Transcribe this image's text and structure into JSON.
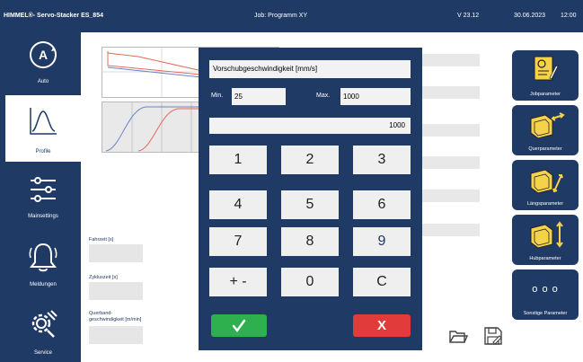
{
  "topbar": {
    "app_title": "HIMMEL®- Servo-Stacker ES_854",
    "job": "Job: Programm XY",
    "version": "V 23.12",
    "date": "30.06.2023",
    "time": "12:00"
  },
  "sidebar": {
    "items": [
      {
        "label": "Auto",
        "icon": "auto-icon"
      },
      {
        "label": "Profile",
        "icon": "profile-curve-icon",
        "active": true
      },
      {
        "label": "Mainsettings",
        "icon": "sliders-icon"
      },
      {
        "label": "Meldungen",
        "icon": "bell-icon"
      },
      {
        "label": "Service",
        "icon": "gear-wrench-icon"
      }
    ]
  },
  "main": {
    "fields": [
      {
        "label": "Fahrzeit [s]"
      },
      {
        "label": "Zykluszeit [s]"
      },
      {
        "label": "Querband-\ngeschwindigkeit [m/min]"
      }
    ]
  },
  "dialog": {
    "title": "Vorschubgeschwindigkeit [mm/s]",
    "min_label": "Min.",
    "min_value": "25",
    "max_label": "Max.",
    "max_value": "1000",
    "current_value": "1000",
    "keys": [
      "1",
      "2",
      "3",
      "4",
      "5",
      "6",
      "7",
      "8",
      "9",
      "+ -",
      "0",
      "C"
    ],
    "confirm_icon": "check-icon",
    "cancel_label": "X"
  },
  "right_panel": {
    "buttons": [
      {
        "label": "Jobparameter",
        "icon": "job-doc-icon"
      },
      {
        "label": "Querparameter",
        "icon": "machine-cross-icon"
      },
      {
        "label": "Längsparameter",
        "icon": "machine-long-icon"
      },
      {
        "label": "Hubparameter",
        "icon": "machine-lift-icon"
      },
      {
        "label": "Sonstige Parameter",
        "icon": "dots-icon",
        "glyph": "o o o"
      }
    ]
  },
  "toolbar": {
    "icons": [
      "open-folder-icon",
      "save-as-icon",
      "download-icon",
      "save-icon"
    ]
  },
  "colors": {
    "navy": "#1f3a64",
    "ok_green": "#2eb04f",
    "cancel_red": "#e23b3b",
    "curve_red": "#e8675a",
    "curve_blue": "#6a7fd0"
  }
}
